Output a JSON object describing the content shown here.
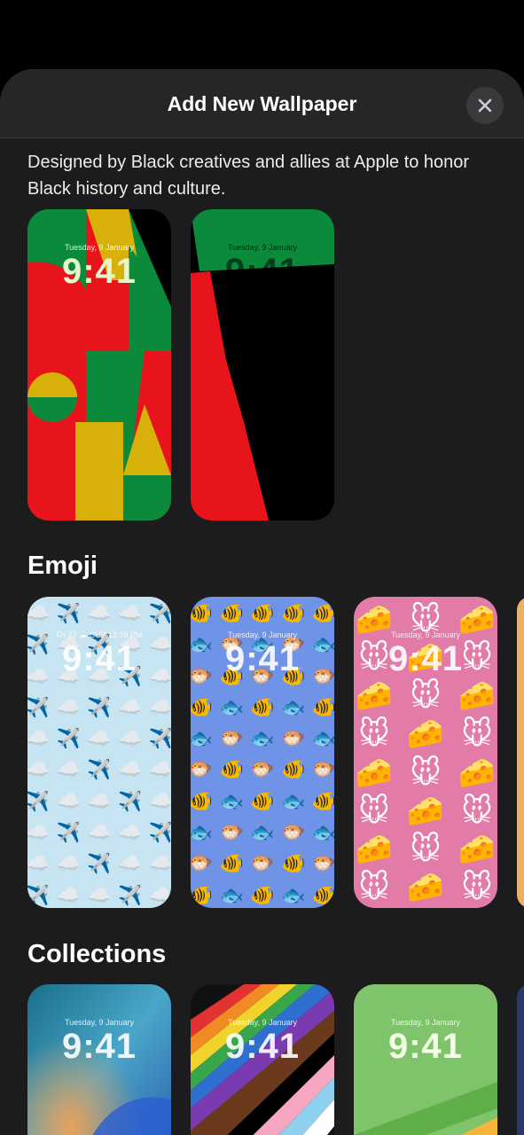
{
  "header": {
    "title": "Add New Wallpaper",
    "close_icon": "close-icon"
  },
  "intro": {
    "text": "Designed by Black creatives and allies at Apple to honor Black history and culture."
  },
  "unity": {
    "cards": [
      {
        "date": "Tuesday, 9 January",
        "time": "9:41"
      },
      {
        "date": "Tuesday, 9 January",
        "time": "9:41"
      }
    ]
  },
  "emoji": {
    "title": "Emoji",
    "cards": [
      {
        "date": "Fri 27  ☁  CUP 12:38 PM",
        "time": "9:41",
        "emoji": "✈️☁️"
      },
      {
        "date": "Tuesday, 9 January",
        "time": "9:41",
        "emoji": "🐟🐡🐠"
      },
      {
        "date": "Tuesday, 9 January",
        "time": "9:41",
        "emoji": "🐭🧀"
      }
    ]
  },
  "collections": {
    "title": "Collections",
    "cards": [
      {
        "date": "Tuesday, 9 January",
        "time": "9:41"
      },
      {
        "date": "Tuesday, 9 January",
        "time": "9:41"
      },
      {
        "date": "Tuesday, 9 January",
        "time": "9:41"
      }
    ]
  },
  "colors": {
    "sheet": "#1c1c1e",
    "green": "#0a8a3a",
    "red": "#e8141b",
    "yellow": "#d8b00a",
    "sky": "#c6e4f2",
    "blue": "#6f93e6",
    "pink": "#e27ba8"
  }
}
